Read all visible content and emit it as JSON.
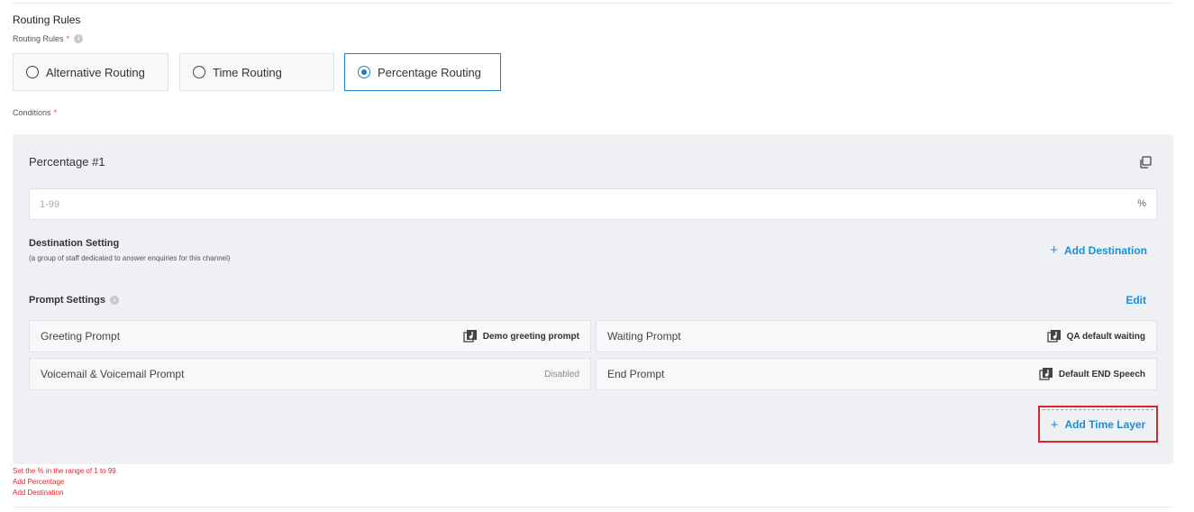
{
  "section": {
    "title": "Routing Rules",
    "routing_label": "Routing Rules",
    "required_mark": "*",
    "conditions_label": "Conditions",
    "info_glyph": "i"
  },
  "routing_options": [
    {
      "label": "Alternative Routing",
      "selected": false
    },
    {
      "label": "Time Routing",
      "selected": false
    },
    {
      "label": "Percentage Routing",
      "selected": true
    }
  ],
  "percentage": {
    "title": "Percentage #1",
    "placeholder": "1-99",
    "value": "",
    "suffix": "%"
  },
  "destination": {
    "title": "Destination Setting",
    "subtitle": "(a group of staff dedicated to answer enquiries for this channel)",
    "add_label": "Add Destination",
    "add_icon": "+"
  },
  "prompts": {
    "title": "Prompt Settings",
    "edit_label": "Edit",
    "items": [
      {
        "name": "Greeting Prompt",
        "value": "Demo greeting prompt",
        "icon": "music-note-icon"
      },
      {
        "name": "Waiting Prompt",
        "value": "QA default waiting",
        "icon": "music-note-icon"
      },
      {
        "name": "Voicemail & Voicemail Prompt",
        "value": "Disabled",
        "icon": ""
      },
      {
        "name": "End Prompt",
        "value": "Default END Speech",
        "icon": "music-note-icon"
      }
    ]
  },
  "add_time_layer": {
    "label": "Add Time Layer",
    "icon": "+"
  },
  "errors": [
    "Set the % in the range of 1 to 99.",
    "Add Percentage",
    "Add Destination"
  ],
  "colors": {
    "accent": "#1a8fd8",
    "selected_border": "#1a7fc4",
    "error": "#e0262c",
    "highlight_border": "#d9262c",
    "panel_bg": "#eef0f3"
  }
}
